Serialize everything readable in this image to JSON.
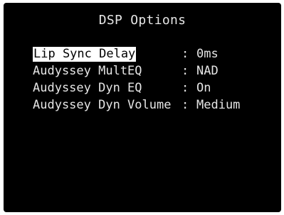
{
  "screen": {
    "title": "DSP Options",
    "separator": ":",
    "items": [
      {
        "label": "Lip Sync Delay",
        "value": "0ms",
        "selected": true
      },
      {
        "label": "Audyssey MultEQ",
        "value": "NAD",
        "selected": false
      },
      {
        "label": "Audyssey Dyn EQ",
        "value": "On",
        "selected": false
      },
      {
        "label": "Audyssey Dyn Volume",
        "value": "Medium",
        "selected": false
      }
    ]
  },
  "colors": {
    "background": "#000000",
    "text": "#e6e6e6",
    "highlight_bg": "#ffffff",
    "highlight_text": "#000000"
  }
}
